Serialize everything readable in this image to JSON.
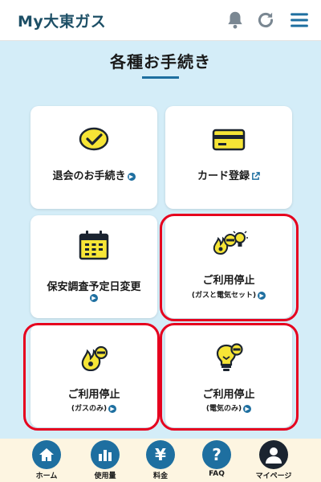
{
  "header": {
    "title": "My大東ガス",
    "icons": [
      "bell-icon",
      "refresh-icon",
      "menu-icon"
    ]
  },
  "page": {
    "title": "各種お手続き"
  },
  "cards": [
    {
      "label": "退会のお手続き",
      "icon": "check-circle-icon"
    },
    {
      "label": "カード登録",
      "icon": "credit-card-icon"
    },
    {
      "label": "保安調査予定日変更",
      "icon": "calendar-icon"
    },
    {
      "label": "ご利用停止",
      "sub": "(ガスと電気セット)",
      "icon": "gas-electric-icon",
      "highlighted": true
    },
    {
      "label": "ご利用停止",
      "sub": "(ガスのみ)",
      "icon": "gas-flame-icon",
      "highlighted": true
    },
    {
      "label": "ご利用停止",
      "sub": "(電気のみ)",
      "icon": "light-bulb-icon",
      "highlighted": true
    }
  ],
  "nav": [
    {
      "label": "ホーム",
      "icon": "home-icon"
    },
    {
      "label": "使用量",
      "icon": "bar-chart-icon"
    },
    {
      "label": "料金",
      "icon": "yen-icon"
    },
    {
      "label": "FAQ",
      "icon": "question-icon"
    },
    {
      "label": "マイページ",
      "icon": "user-icon"
    }
  ],
  "colors": {
    "brand_dark": "#1d4f66",
    "accent_blue": "#1e6fa0",
    "background": "#d4edf8",
    "icon_yellow": "#f6e536",
    "highlight_red": "#e6001e",
    "nav_background": "#fdf5e1"
  }
}
